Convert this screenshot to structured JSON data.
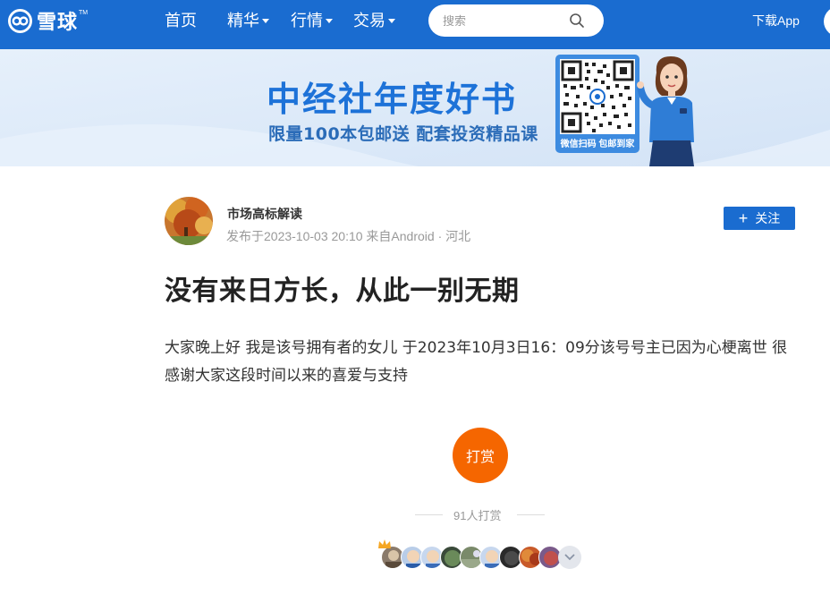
{
  "nav": {
    "logo_text": "雪球",
    "logo_tm": "TM",
    "items": [
      {
        "label": "首页"
      },
      {
        "label": "精华"
      },
      {
        "label": "行情"
      },
      {
        "label": "交易"
      }
    ],
    "search_placeholder": "搜索",
    "download_label": "下载App"
  },
  "banner": {
    "title": "中经社年度好书",
    "subtitle": "限量100本包邮送 配套投资精品课",
    "qr_caption": "微信扫码 包邮到家"
  },
  "post": {
    "author": "市场高标解读",
    "meta": "发布于2023-10-03 20:10  来自Android · 河北",
    "follow_label": "关注",
    "title": "没有来日方长，从此一别无期",
    "body": "大家晚上好 我是该号拥有者的女儿 于2023年10月3日16：09分该号号主已因为心梗离世 很感谢大家这段时间以来的喜爱与支持"
  },
  "reward": {
    "button_label": "打赏",
    "count_text": "91人打赏"
  },
  "colors": {
    "brand_blue": "#1a6cd0",
    "reward_orange": "#f56600",
    "banner_bg": "#dce9f8"
  },
  "icons": {
    "search": "search-icon",
    "caret": "chevron-down-icon",
    "follow": "plus-icon",
    "more": "chevron-down-icon",
    "crown": "crown-icon"
  }
}
